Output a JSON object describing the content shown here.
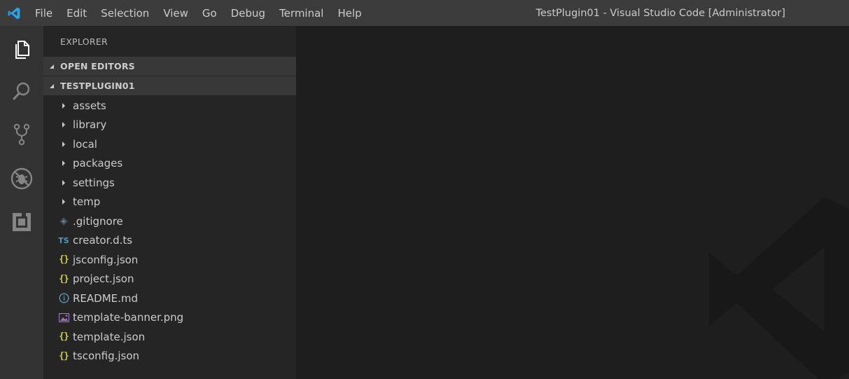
{
  "titlebar": {
    "menu": [
      "File",
      "Edit",
      "Selection",
      "View",
      "Go",
      "Debug",
      "Terminal",
      "Help"
    ],
    "window_title": "TestPlugin01 - Visual Studio Code [Administrator]",
    "logo_icon": "vscode-logo-icon"
  },
  "activity_bar": {
    "items": [
      {
        "icon": "files-icon",
        "label": "Explorer"
      },
      {
        "icon": "search-icon",
        "label": "Search"
      },
      {
        "icon": "source-control-icon",
        "label": "Source Control"
      },
      {
        "icon": "debug-icon",
        "label": "Debug"
      },
      {
        "icon": "extensions-icon",
        "label": "Extensions"
      }
    ]
  },
  "sidebar": {
    "title": "EXPLORER",
    "sections": {
      "open_editors": "OPEN EDITORS",
      "project": "TESTPLUGIN01"
    },
    "tree": [
      {
        "type": "folder",
        "label": "assets"
      },
      {
        "type": "folder",
        "label": "library"
      },
      {
        "type": "folder",
        "label": "local"
      },
      {
        "type": "folder",
        "label": "packages"
      },
      {
        "type": "folder",
        "label": "settings"
      },
      {
        "type": "folder",
        "label": "temp"
      },
      {
        "type": "git",
        "label": ".gitignore"
      },
      {
        "type": "ts",
        "label": "creator.d.ts",
        "glyph": "TS"
      },
      {
        "type": "json",
        "label": "jsconfig.json",
        "glyph": "{}"
      },
      {
        "type": "json",
        "label": "project.json",
        "glyph": "{}"
      },
      {
        "type": "info",
        "label": "README.md"
      },
      {
        "type": "image",
        "label": "template-banner.png"
      },
      {
        "type": "json",
        "label": "template.json",
        "glyph": "{}"
      },
      {
        "type": "json",
        "label": "tsconfig.json",
        "glyph": "{}"
      }
    ]
  },
  "colors": {
    "titlebar": "#3c3c3c",
    "activitybar": "#333333",
    "sidebar": "#252526",
    "editor": "#1e1e1e",
    "accent": "#007acc"
  }
}
